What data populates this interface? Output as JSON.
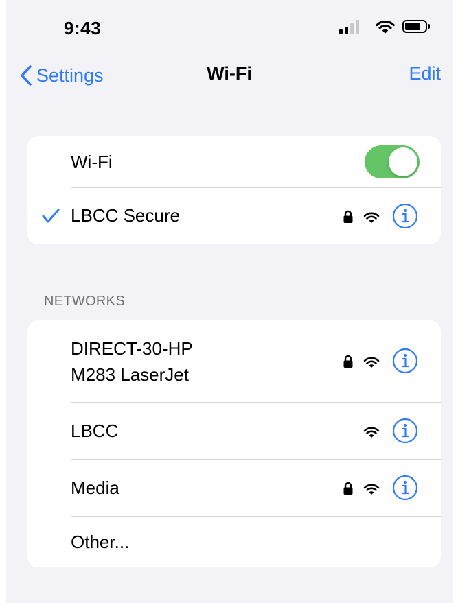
{
  "status_bar": {
    "time": "9:43"
  },
  "nav": {
    "back_label": "Settings",
    "title": "Wi-Fi",
    "edit_label": "Edit"
  },
  "wifi_card": {
    "toggle_label": "Wi-Fi",
    "toggle_on": true,
    "connected_network": "LBCC Secure"
  },
  "networks": {
    "header": "NETWORKS",
    "items": [
      {
        "line1": "DIRECT-30-HP",
        "line2": "M283 LaserJet",
        "locked": true
      },
      {
        "line1": "LBCC",
        "locked": false
      },
      {
        "line1": "Media",
        "locked": true
      }
    ],
    "other_label": "Other..."
  },
  "colors": {
    "accent": "#2f7cf6",
    "toggle_on": "#64c466",
    "background": "#f2f2f7"
  }
}
